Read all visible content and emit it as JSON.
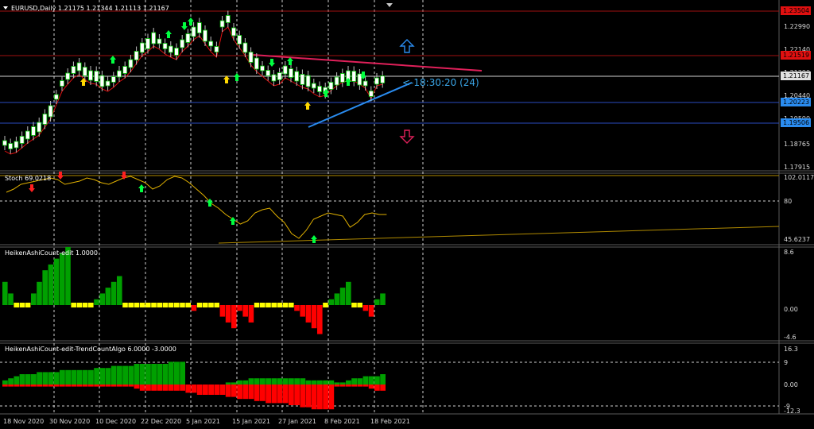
{
  "colors": {
    "background": "#000000",
    "grid": "#c8c8c8",
    "candle_bull": "#ffffff",
    "candle_bear": "#ffffff",
    "candle_outline": "#00c000",
    "ma": "#e01010",
    "stoch": "#e0b000",
    "trendline_red": "#e0205a",
    "trendline_blue": "#2a8cf0",
    "hline_red": "#a01010",
    "hline_blue": "#2a4cc0",
    "hist_green": "#00a000",
    "hist_red": "#ff0000",
    "hist_yellow": "#ffff00",
    "arrow_up": "#00ff40",
    "arrow_down": "#ff2020",
    "arrow_yellow": "#ffd800"
  },
  "main": {
    "title": "EURUSD,Daily  1.21175 1.21344 1.21113 1.21167",
    "timer": "<-18:30:20 (24)",
    "price_labels": [
      "1.22990",
      "1.22140",
      "1.21290",
      "1.20440",
      "1.19590",
      "1.18765",
      "1.17915"
    ],
    "badges": [
      {
        "text": "1.23504",
        "color": "#e01010"
      },
      {
        "text": "1.21519",
        "color": "#e01010"
      },
      {
        "text": "1.21167",
        "color": "#e0e0e0"
      },
      {
        "text": "1.20223",
        "color": "#2a8cf0"
      },
      {
        "text": "1.19506",
        "color": "#2a8cf0"
      }
    ],
    "nav_icons": [
      "arrow-up-outline-icon",
      "arrow-down-outline-icon"
    ]
  },
  "stoch": {
    "title": "Stoch 69.0218",
    "labels": [
      "102.0117",
      "80",
      "45.6237"
    ]
  },
  "ha1": {
    "title": "HeikenAshiCount-edit 1.0000",
    "labels": [
      "8.6",
      "0.00",
      "-4.6"
    ]
  },
  "ha2": {
    "title": "HeikenAshiCount-edit-TrendCountAlgo 6.0000 -3.0000",
    "labels": [
      "16.3",
      "9",
      "0.00",
      "-9",
      "-12.3"
    ]
  },
  "dates": [
    "18 Nov 2020",
    "30 Nov 2020",
    "10 Dec 2020",
    "22 Dec 2020",
    "5 Jan 2021",
    "15 Jan 2021",
    "27 Jan 2021",
    "8 Feb 2021",
    "18 Feb 2021"
  ],
  "ha1_counts": [
    4,
    2,
    0,
    0,
    0,
    2,
    4,
    6,
    7,
    8,
    9,
    10,
    0,
    0,
    0,
    0,
    1,
    2,
    3,
    4,
    5,
    0,
    0,
    0,
    0,
    0,
    0,
    0,
    0,
    0,
    0,
    0,
    0,
    -1,
    0,
    0,
    0,
    0,
    -2,
    -3,
    -4,
    -1,
    -2,
    -3,
    0,
    0,
    0,
    0,
    0,
    0,
    0,
    -1,
    -2,
    -3,
    -4,
    -5,
    0,
    1,
    2,
    3,
    4,
    0,
    0,
    -1,
    -2,
    1,
    2
  ],
  "ha2_trend": [
    2,
    3,
    4,
    5,
    5,
    5,
    6,
    6,
    6,
    6,
    7,
    7,
    7,
    7,
    7,
    7,
    8,
    8,
    8,
    9,
    9,
    9,
    9,
    10,
    10,
    10,
    10,
    10,
    10,
    11,
    11,
    11,
    0,
    0,
    0,
    0,
    0,
    0,
    0,
    1,
    1,
    2,
    2,
    3,
    3,
    3,
    3,
    3,
    3,
    3,
    3,
    3,
    3,
    2,
    2,
    2,
    2,
    2,
    1,
    1,
    2,
    3,
    3,
    4,
    4,
    4,
    5
  ],
  "ha2_counter": [
    -1,
    -1,
    -1,
    -1,
    -1,
    -1,
    -1,
    -1,
    -1,
    -1,
    -1,
    -1,
    -1,
    -1,
    -1,
    -1,
    -1,
    -1,
    -1,
    -1,
    -1,
    -1,
    -1,
    -2,
    -3,
    -3,
    -3,
    -3,
    -3,
    -3,
    -3,
    -3,
    -4,
    -4,
    -5,
    -5,
    -5,
    -5,
    -5,
    -6,
    -6,
    -7,
    -7,
    -7,
    -8,
    -8,
    -9,
    -9,
    -9,
    -9,
    -10,
    -10,
    -11,
    -11,
    -12,
    -12,
    -12,
    -12,
    -1,
    -1,
    -1,
    -1,
    -1,
    -1,
    -2,
    -3,
    -3
  ]
}
